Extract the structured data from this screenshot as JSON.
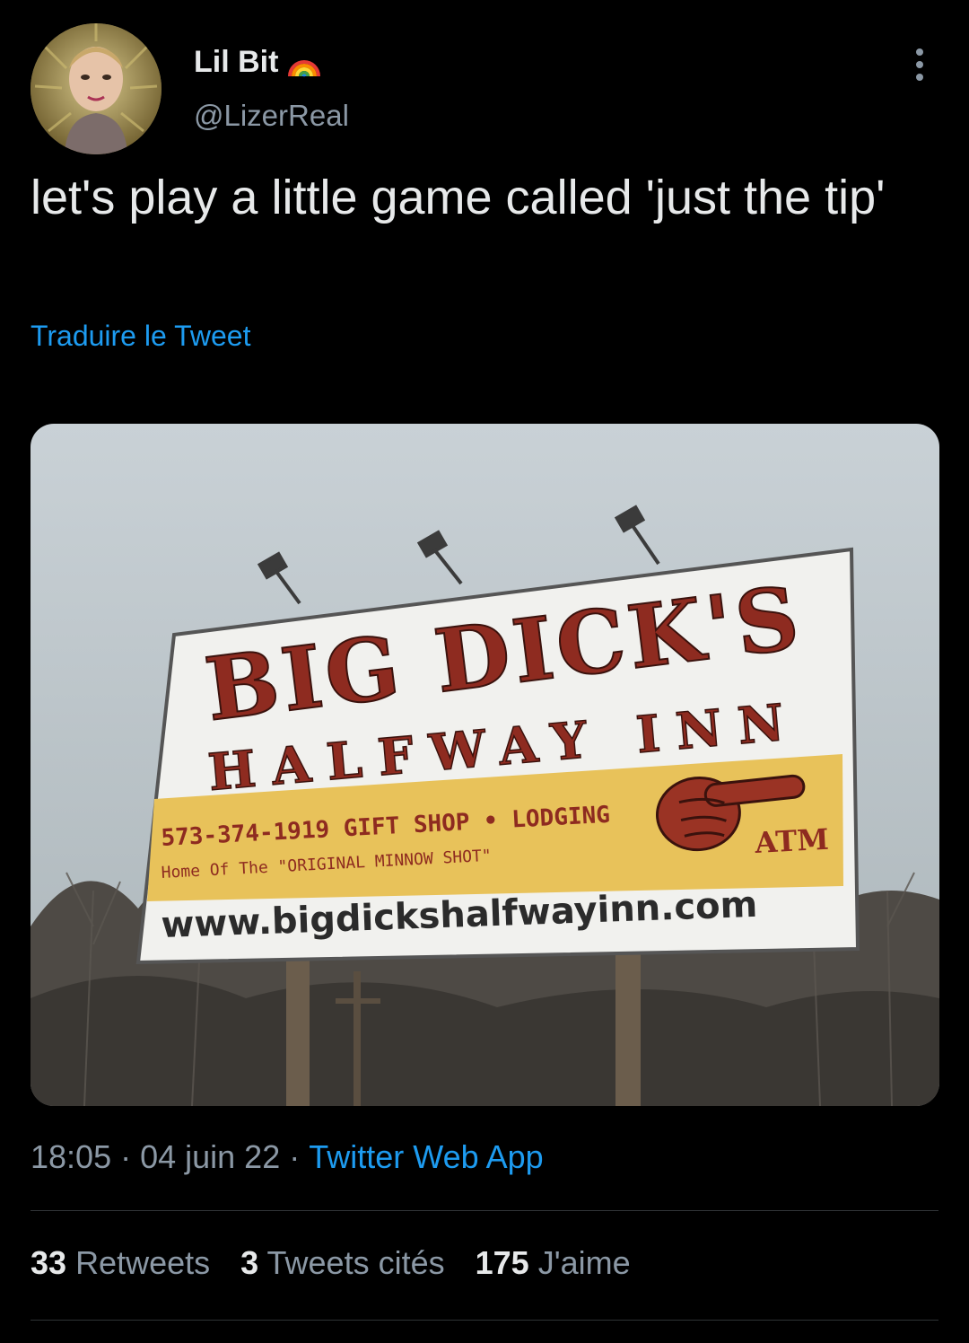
{
  "tweet": {
    "display_name": "Lil Bit",
    "name_emoji_icon": "rainbow-icon",
    "handle": "@LizerReal",
    "text": "let's play a little game called 'just the tip'",
    "translate_label": "Traduire le Tweet",
    "time": "18:05",
    "date": "04 juin 22",
    "separator": "·",
    "source": "Twitter Web App"
  },
  "media": {
    "sign_title_1": "BIG DICK'S",
    "sign_title_2": "HALFWAY INN",
    "sign_phone_line": "573-374-1919 GIFT SHOP • LODGING",
    "sign_sub_line": "Home Of The \"ORIGINAL MINNOW SHOT\"",
    "sign_atm": "ATM",
    "sign_url": "www.bigdickshalfwayinn.com"
  },
  "stats": {
    "retweets_count": "33",
    "retweets_label": "Retweets",
    "quotes_count": "3",
    "quotes_label": "Tweets cités",
    "likes_count": "175",
    "likes_label": "J'aime"
  },
  "colors": {
    "background": "#000000",
    "text": "#e7e9ea",
    "secondary": "#8b98a5",
    "link": "#1d9bf0",
    "sign_red": "#8e2b20",
    "sign_yellow": "#e8c25a"
  }
}
